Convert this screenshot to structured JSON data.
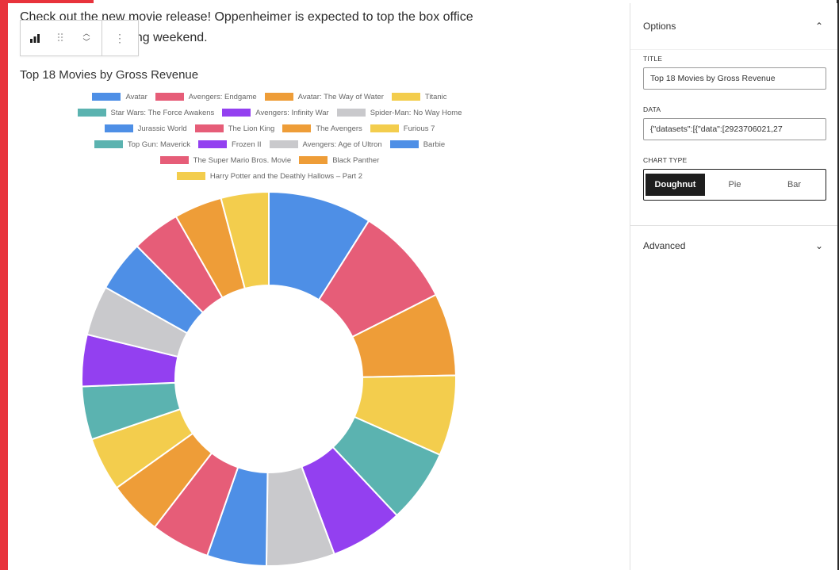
{
  "paragraph": "Check out the new movie release! Oppenheimer is expected to top the box office records on the opening weekend.",
  "toolbar": {
    "chart_icon": "bar-chart-icon",
    "drag_icon": "drag-handle-icon",
    "move_up_icon": "chevron-up-icon",
    "move_down_icon": "chevron-down-icon",
    "more_icon": "more-vertical-icon"
  },
  "chart_data": {
    "type": "doughnut",
    "title": "Top 18 Movies by Gross Revenue",
    "categories": [
      "Avatar",
      "Avengers: Endgame",
      "Avatar: The Way of Water",
      "Titanic",
      "Star Wars: The Force Awakens",
      "Avengers: Infinity War",
      "Spider-Man: No Way Home",
      "Jurassic World",
      "The Lion King",
      "The Avengers",
      "Furious 7",
      "Top Gun: Maverick",
      "Frozen II",
      "Avengers: Age of Ultron",
      "Barbie",
      "The Super Mario Bros. Movie",
      "Black Panther",
      "Harry Potter and the Deathly Hallows – Part 2"
    ],
    "values": [
      2923706026,
      2799439100,
      2320250281,
      2264743305,
      2071310218,
      2052415039,
      1921847111,
      1671537444,
      1663075401,
      1520538536,
      1515341399,
      1495696292,
      1453683476,
      1405018048,
      1441800000,
      1361992475,
      1347597973,
      1342359942
    ],
    "colors": [
      "#4e8fe6",
      "#e65d78",
      "#ee9d38",
      "#f3cd4d",
      "#5bb3b0",
      "#9340f0",
      "#c9c9cc",
      "#4e8fe6",
      "#e65d78",
      "#ee9d38",
      "#f3cd4d",
      "#5bb3b0",
      "#9340f0",
      "#c9c9cc",
      "#4e8fe6",
      "#e65d78",
      "#ee9d38",
      "#f3cd4d"
    ],
    "legend_position": "top"
  },
  "sidebar": {
    "options_title": "Options",
    "options_chevron": "chevron-up-icon",
    "title_label": "TITLE",
    "title_value": "Top 18 Movies by Gross Revenue",
    "data_label": "DATA",
    "data_value": "{\"datasets\":[{\"data\":[2923706021,27",
    "chart_type_label": "CHART TYPE",
    "chart_types": [
      "Doughnut",
      "Pie",
      "Bar"
    ],
    "selected_chart_type": "Doughnut",
    "advanced_title": "Advanced",
    "advanced_chevron": "chevron-down-icon"
  }
}
